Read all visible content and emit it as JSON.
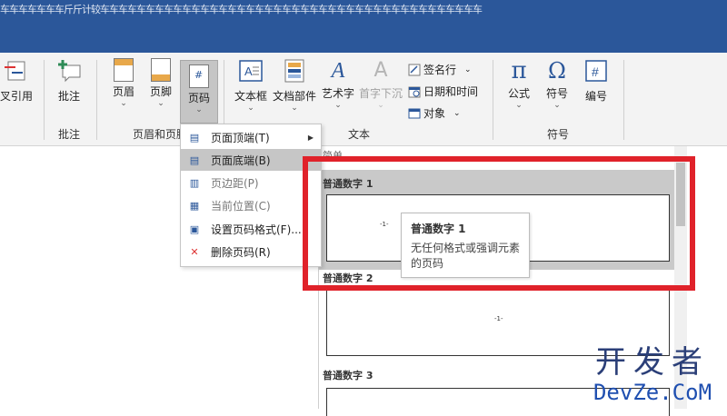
{
  "window": {
    "title_strip": "车车车车车车车斤斤计较车车车车车车车车车车车车车车车车车车车车车车车车车车车车车车车车车车车车车车车车车车"
  },
  "ribbon": {
    "buttons": {
      "cross_reference": "叉引用",
      "comment": "批注",
      "header": "页眉",
      "footer": "页脚",
      "page_number": "页码",
      "text_box": "文本框",
      "doc_parts": "文档部件",
      "wordart": "艺术字",
      "drop_cap": "首字下沉",
      "signature_line": "签名行",
      "date_time": "日期和时间",
      "object": "对象",
      "equation": "公式",
      "symbol": "符号",
      "number": "编号"
    },
    "glyphs": {
      "pi": "π",
      "omega": "Ω",
      "hash": "#",
      "A": "A"
    },
    "groups": {
      "comments": "批注",
      "header_footer": "页眉和页脚",
      "text": "文本",
      "symbols": "符号"
    }
  },
  "menu": {
    "items": [
      {
        "label": "页面顶端(T)",
        "icon": "page-top-icon",
        "submenu": true,
        "state": "normal"
      },
      {
        "label": "页面底端(B)",
        "icon": "page-bottom-icon",
        "submenu": false,
        "state": "hover"
      },
      {
        "label": "页边距(P)",
        "icon": "page-margin-icon",
        "submenu": false,
        "state": "disabled"
      },
      {
        "label": "当前位置(C)",
        "icon": "current-position-icon",
        "submenu": false,
        "state": "disabled"
      },
      {
        "label": "设置页码格式(F)...",
        "icon": "format-page-number-icon",
        "submenu": false,
        "state": "normal"
      },
      {
        "label": "删除页码(R)",
        "icon": "delete-page-number-icon",
        "submenu": false,
        "state": "normal"
      }
    ]
  },
  "gallery": {
    "section_heading": "简单",
    "items": [
      {
        "name": "普通数字 1",
        "page_number": "-1-",
        "selected": true
      },
      {
        "name": "普通数字 2",
        "page_number": "-1-",
        "selected": false
      },
      {
        "name": "普通数字 3",
        "page_number": "",
        "selected": false
      }
    ]
  },
  "tooltip": {
    "title": "普通数字 1",
    "description": "无任何格式或强调元素的页码"
  },
  "watermark": {
    "cn": "开发者",
    "en": "DevZe.CoM"
  },
  "colors": {
    "title_bar": "#2b579a",
    "highlight": "#e0222a",
    "menu_hover": "#c6c6c6"
  }
}
